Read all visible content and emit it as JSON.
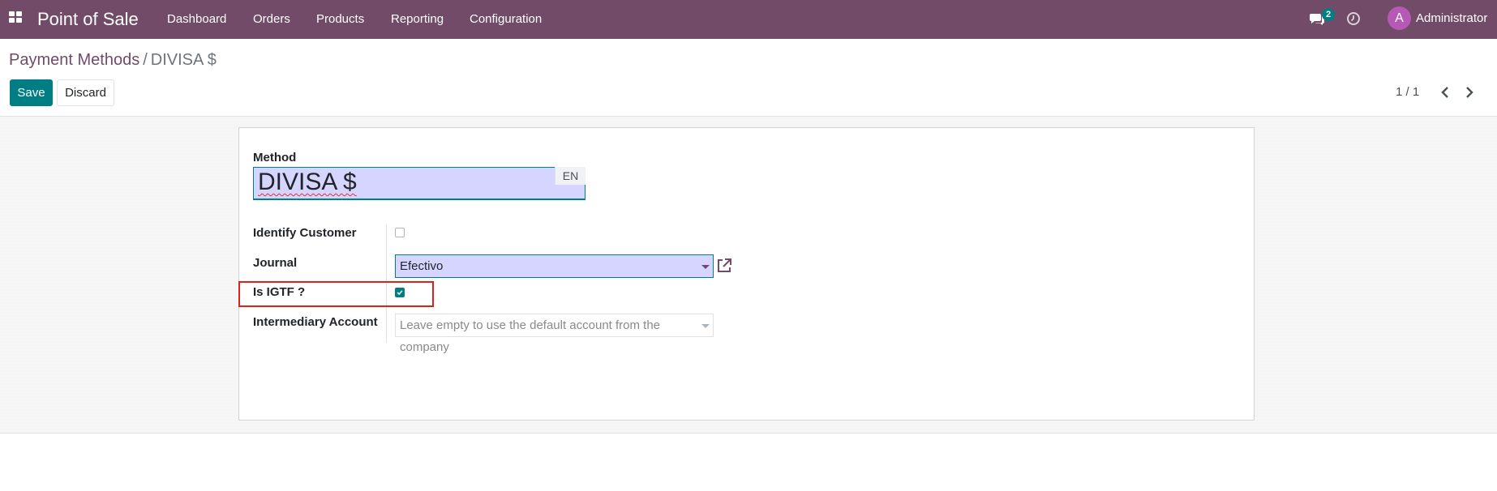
{
  "navbar": {
    "app_title": "Point of Sale",
    "menu": [
      "Dashboard",
      "Orders",
      "Products",
      "Reporting",
      "Configuration"
    ],
    "chat_badge": "2",
    "avatar_letter": "A",
    "user_name": "Administrator",
    "icons": [
      "apps-grid-icon",
      "chat-icon",
      "clock-icon"
    ]
  },
  "breadcrumb": {
    "parent": "Payment Methods",
    "separator": "/",
    "current": "DIVISA $"
  },
  "toolbar": {
    "save_label": "Save",
    "discard_label": "Discard"
  },
  "pager": {
    "value": "1 / 1",
    "icons": [
      "chevron-left-icon",
      "chevron-right-icon"
    ]
  },
  "form": {
    "method_label": "Method",
    "method_value": "DIVISA $",
    "lang_badge": "EN",
    "identify_customer_label": "Identify Customer",
    "identify_customer_checked": false,
    "journal_label": "Journal",
    "journal_value": "Efectivo",
    "is_igtf_label": "Is IGTF ?",
    "is_igtf_checked": true,
    "intermediary_account_label": "Intermediary Account",
    "intermediary_account_placeholder": "Leave empty to use the default account from the company"
  },
  "colors": {
    "navbar": "#714b67",
    "primary": "#017e84",
    "input_highlight": "#d5d5ff",
    "highlight_box": "#e0201b"
  }
}
